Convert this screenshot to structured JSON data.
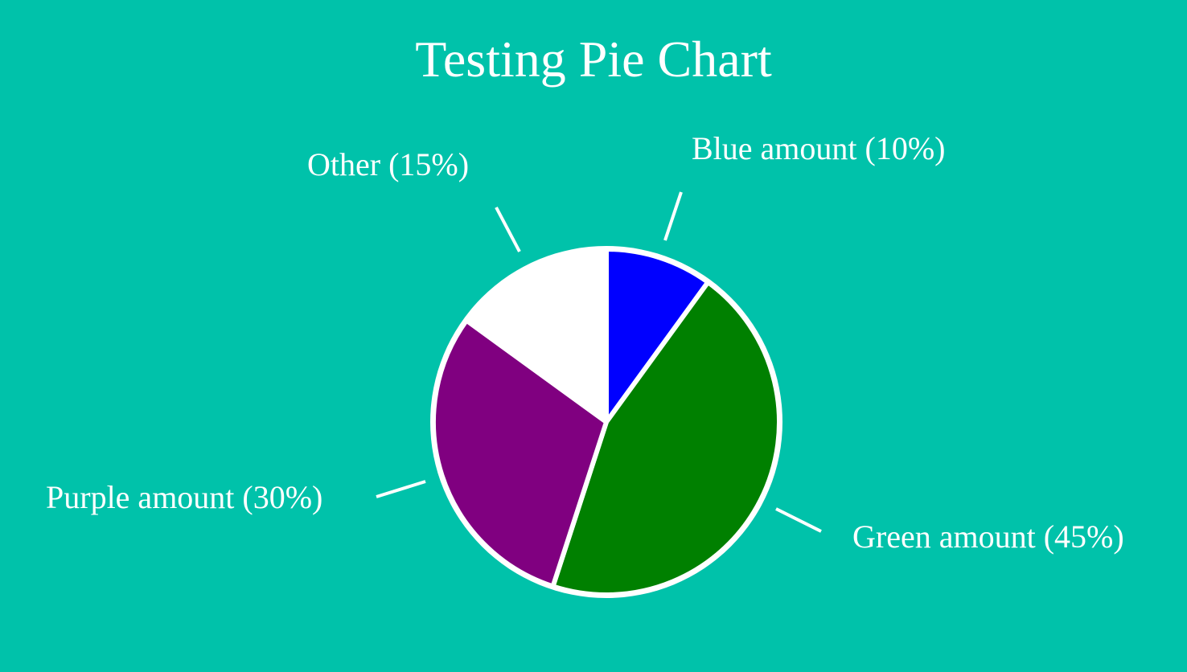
{
  "chart_data": {
    "type": "pie",
    "title": "Testing Pie Chart",
    "slices": [
      {
        "label": "Blue amount (10%)",
        "value": 10,
        "color": "#0000ff"
      },
      {
        "label": "Green amount (45%)",
        "value": 45,
        "color": "#008000"
      },
      {
        "label": "Purple amount (30%)",
        "value": 30,
        "color": "#800080"
      },
      {
        "label": "Other (15%)",
        "value": 15,
        "color": "#ffffff"
      }
    ]
  },
  "colors": {
    "background": "#00c2aa",
    "text": "#ffffff",
    "outline": "#ffffff"
  }
}
